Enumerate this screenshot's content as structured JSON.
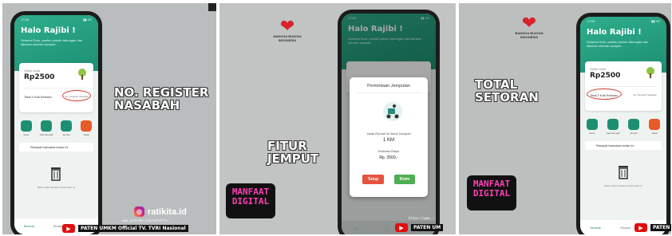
{
  "app": {
    "greeting": "Halo Rajibi !",
    "subtitle": "Selamat Sore, pantau jumlah tabungan dan lakukan setoran sampah",
    "saldo_label": "Saldo anda",
    "saldo_value": "Rp2500",
    "total_setoran": "Total 2 Kali Setoran",
    "register_label": "No. Register Nasabah",
    "features": [
      "Setor",
      "Jual Sampah",
      "Jemput",
      "Tukar"
    ],
    "riwayat": "Riwayat transaksi bulan ini",
    "empty": "Belum ada transaksi untuk bulan ini",
    "nav": [
      "Beranda",
      "Riwayat",
      "Profil"
    ]
  },
  "panel1": {
    "caption": [
      "NO. REGISTER",
      "NASABAH"
    ],
    "instagram": "ratikita.id",
    "yt_url": "www.youtube.com/watch?v=...",
    "yt_label": "PATEN UMKM Official TV. TVRI Nasional"
  },
  "panel2": {
    "logo_text": [
      "BANGGA BUATAN",
      "INDONESIA"
    ],
    "caption": [
      "FITUR",
      "JEMPUT"
    ],
    "badge": [
      "MANFAAT",
      "DIGITAL"
    ],
    "dialog": {
      "title": "Permintaan Jemputan",
      "distance_label": "Jarak Rumah ke Bank Sampah",
      "distance": "1 KM",
      "cost_label": "Estimasi Biaya",
      "cost": "Rp. 2500,-",
      "cancel": "Tutup",
      "send": "Kirim"
    },
    "yt_url": "https://www...",
    "yt_label": "PATEN UM"
  },
  "panel3": {
    "logo_text": [
      "BANGGA BUATAN",
      "INDONESIA"
    ],
    "caption": [
      "TOTAL",
      "SETORAN"
    ],
    "badge": [
      "MANFAAT",
      "DIGITAL"
    ],
    "yt_label": "PATEN"
  },
  "colors": {
    "primary": "#2fae8c",
    "badge_text": "#ff3fb3",
    "accent_red": "#d23b2b"
  }
}
